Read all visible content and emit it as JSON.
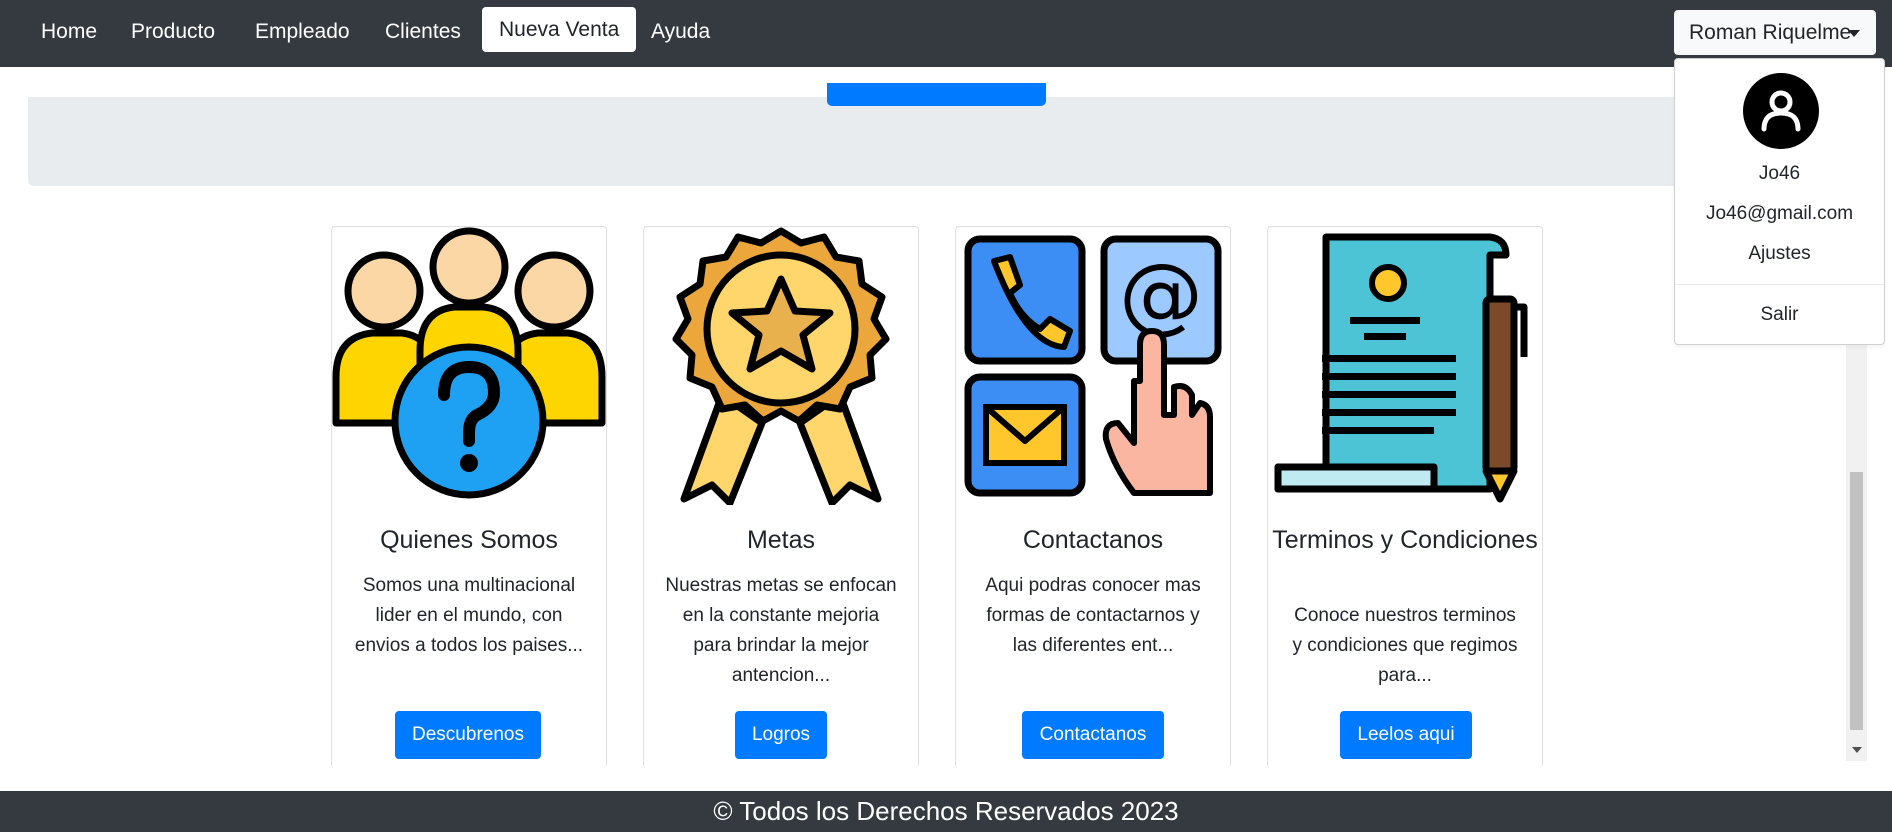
{
  "navbar": {
    "items": [
      {
        "label": "Home"
      },
      {
        "label": "Producto"
      },
      {
        "label": "Empleado"
      },
      {
        "label": "Clientes"
      },
      {
        "label": "Nueva Venta",
        "active": true
      },
      {
        "label": "Ayuda"
      }
    ],
    "user_label": "Roman Riquelme"
  },
  "dropdown": {
    "avatar_icon": "user-circle-icon",
    "username": "Jo46",
    "email": "Jo46@gmail.com",
    "settings": "Ajustes",
    "logout": "Salir"
  },
  "cards": [
    {
      "icon": "team-question-icon",
      "title": "Quienes Somos",
      "text": "Somos una multinacional lider en el mundo, con envios a todos los paises...",
      "button": "Descubrenos"
    },
    {
      "icon": "award-medal-icon",
      "title": "Metas",
      "text": "Nuestras metas se enfocan en la constante mejoria para brindar la mejor antencion...",
      "button": "Logros"
    },
    {
      "icon": "contact-channels-icon",
      "title": "Contactanos",
      "text": "Aqui podras conocer mas formas de contactarnos y las diferentes ent...",
      "button": "Contactanos"
    },
    {
      "icon": "terms-document-icon",
      "title": "Terminos y Condiciones",
      "text": "Conoce nuestros terminos y condiciones que regimos para...",
      "button": "Leelos aqui"
    }
  ],
  "footer": {
    "text": "© Todos los Derechos Reservados 2023"
  },
  "colors": {
    "navbar": "#343a40",
    "primary": "#007bff",
    "jumbotron": "#e9ecef"
  }
}
